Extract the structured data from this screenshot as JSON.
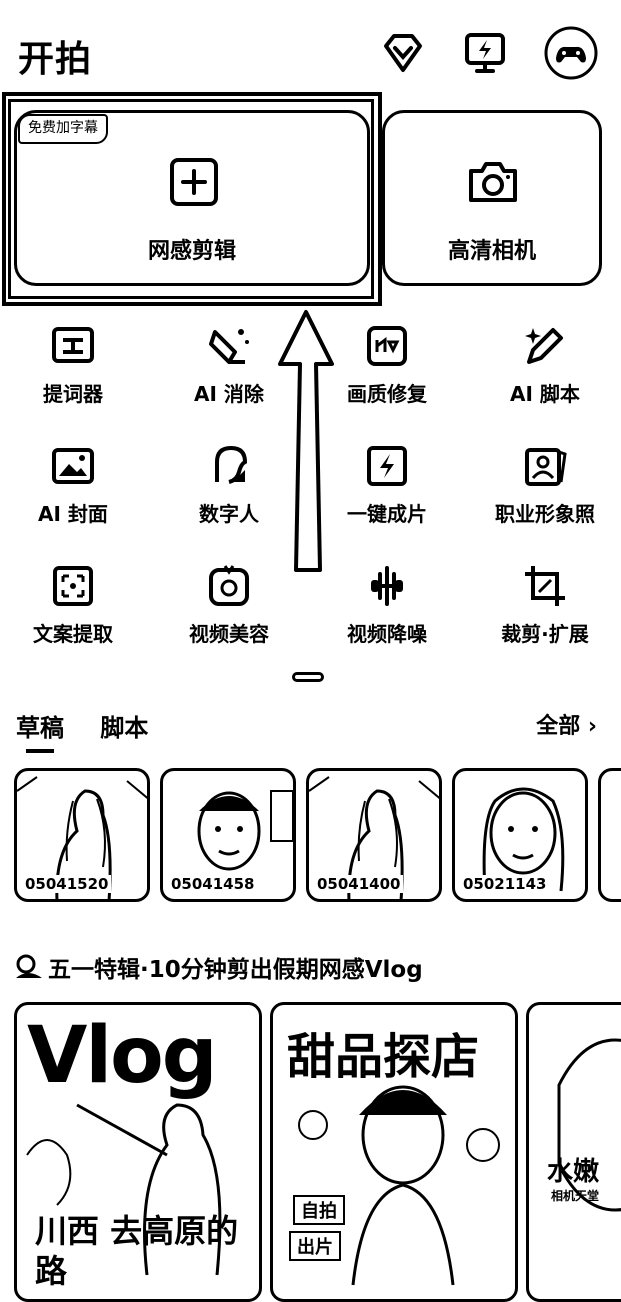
{
  "header": {
    "title": "开拍",
    "icons": [
      "vip-icon",
      "screen-cast-icon",
      "game-avatar-icon"
    ]
  },
  "cards": [
    {
      "badge": "免费加字幕",
      "label": "网感剪辑",
      "icon": "plus-icon"
    },
    {
      "label": "高清相机",
      "icon": "camera-icon"
    }
  ],
  "tools": [
    {
      "label": "提词器",
      "icon": "teleprompter-icon"
    },
    {
      "label": "AI 消除",
      "icon": "eraser-icon"
    },
    {
      "label": "画质修复",
      "icon": "quality-repair-icon"
    },
    {
      "label": "AI 脚本",
      "icon": "ai-script-icon"
    },
    {
      "label": "AI 封面",
      "icon": "cover-image-icon"
    },
    {
      "label": "数字人",
      "icon": "digital-human-icon"
    },
    {
      "label": "一键成片",
      "icon": "one-click-video-icon"
    },
    {
      "label": "职业形象照",
      "icon": "id-photo-icon"
    },
    {
      "label": "文案提取",
      "icon": "text-extract-icon"
    },
    {
      "label": "视频美容",
      "icon": "video-beauty-icon"
    },
    {
      "label": "视频降噪",
      "icon": "denoise-icon"
    },
    {
      "label": "裁剪·扩展",
      "icon": "crop-expand-icon"
    }
  ],
  "drafts": {
    "tabs": [
      "草稿",
      "脚本"
    ],
    "all_label": "全部",
    "items": [
      {
        "code": "05041520"
      },
      {
        "code": "05041458"
      },
      {
        "code": "05041400"
      },
      {
        "code": "05021143"
      }
    ]
  },
  "section": {
    "title": "五一特辑·10分钟剪出假期网感Vlog",
    "templates": [
      {
        "title": "Vlog",
        "subtitle": "川西 去高原的路"
      },
      {
        "title": "甜品探店",
        "tag1": "自拍",
        "tag2": "出片"
      },
      {
        "title": "水嫩",
        "subtitle": "相机天堂"
      }
    ]
  }
}
